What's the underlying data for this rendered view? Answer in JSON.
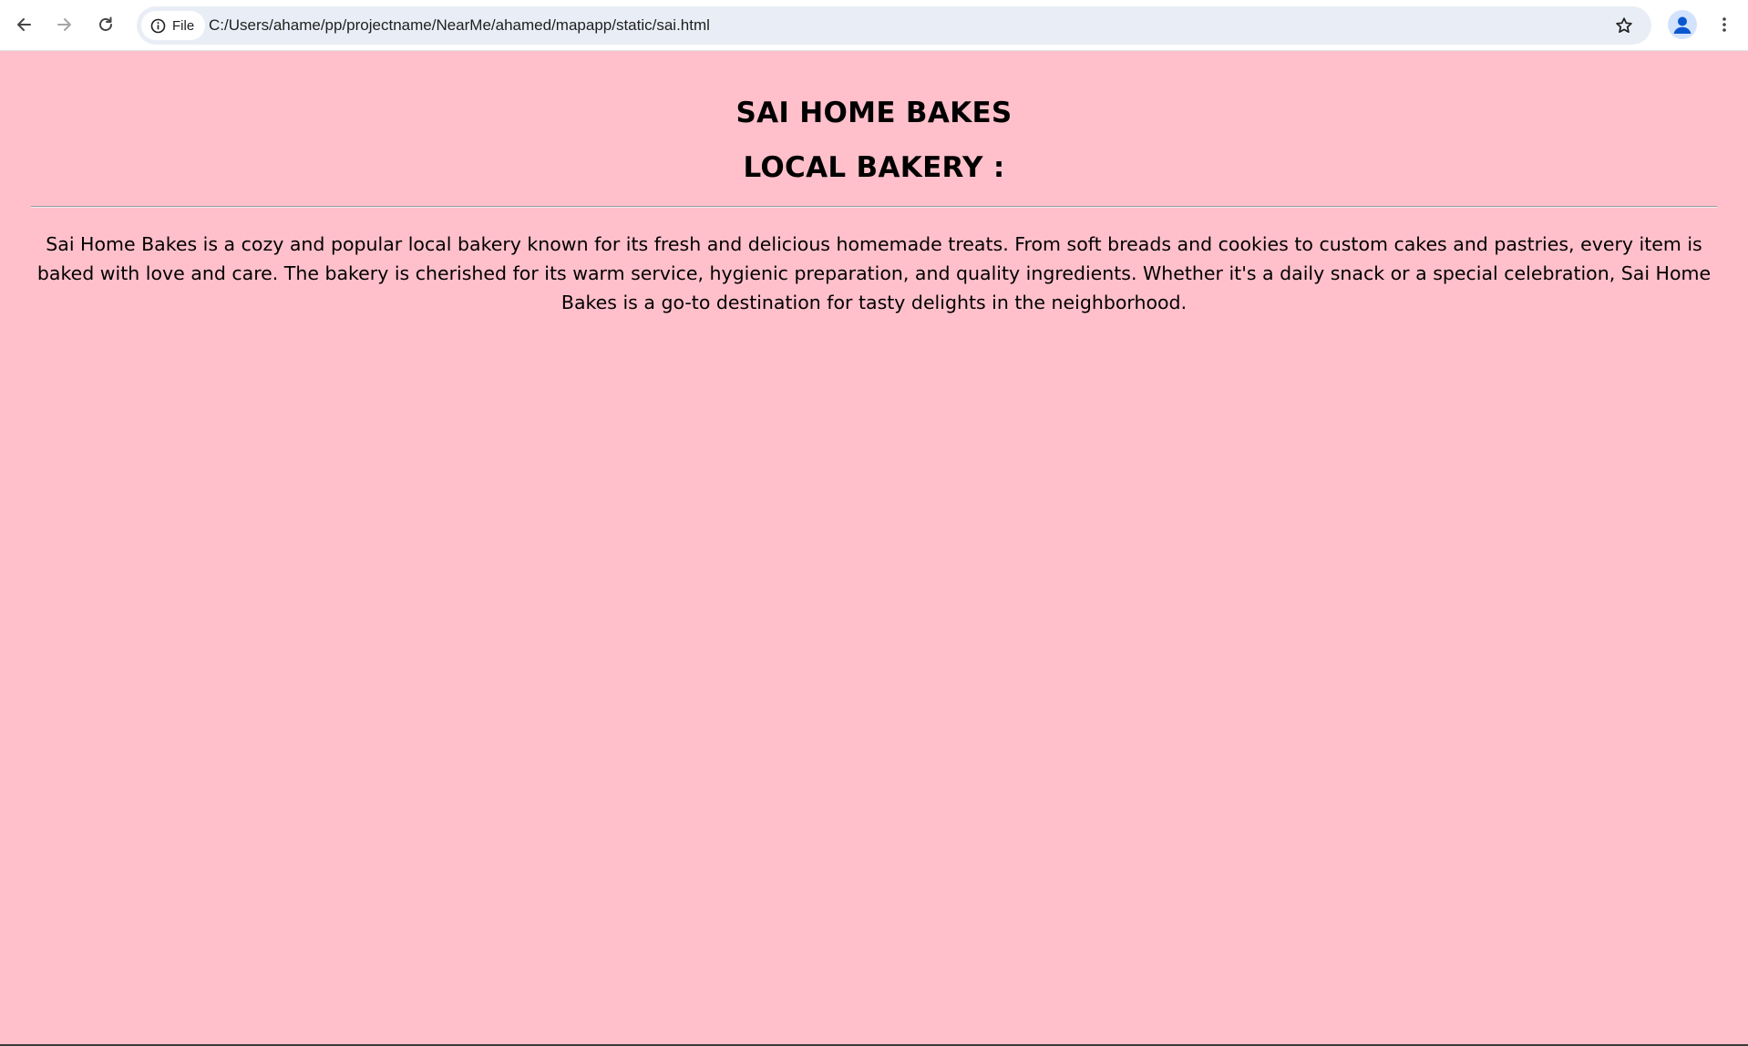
{
  "browser": {
    "site_info_label": "File",
    "url": "C:/Users/ahame/pp/projectname/NearMe/ahamed/mapapp/static/sai.html",
    "icons": {
      "back": "back-arrow-icon",
      "forward": "forward-arrow-icon",
      "reload": "reload-icon",
      "site_info": "info-icon",
      "bookmark": "star-icon",
      "profile": "person-icon",
      "menu": "vertical-dots-icon"
    }
  },
  "page": {
    "background_color": "#ffc0cb",
    "title": "SAI HOME BAKES",
    "subtitle": "LOCAL BAKERY :",
    "description": "Sai Home Bakes is a cozy and popular local bakery known for its fresh and delicious homemade treats. From soft breads and cookies to custom cakes and pastries, every item is baked with love and care. The bakery is cherished for its warm service, hygienic preparation, and quality ingredients. Whether it's a daily snack or a special celebration, Sai Home Bakes is a go-to destination for tasty delights in the neighborhood."
  }
}
